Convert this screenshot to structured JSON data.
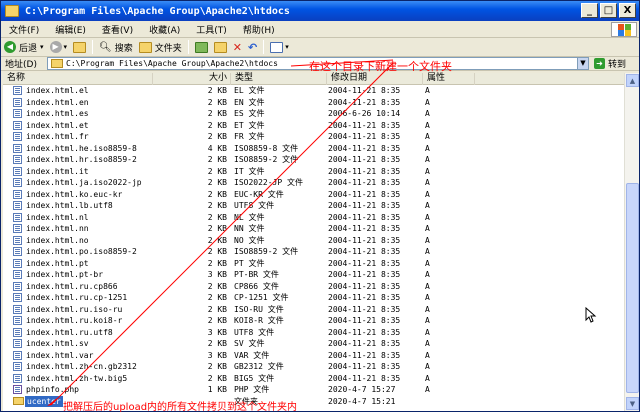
{
  "window": {
    "title": "C:\\Program Files\\Apache Group\\Apache2\\htdocs",
    "buttons": [
      "_",
      "□",
      "X"
    ]
  },
  "menu": [
    "文件(F)",
    "编辑(E)",
    "查看(V)",
    "收藏(A)",
    "工具(T)",
    "帮助(H)"
  ],
  "toolbar": {
    "back": "后退",
    "search": "搜索",
    "folders": "文件夹"
  },
  "address": {
    "label": "地址(D)",
    "path": "C:\\Program Files\\Apache Group\\Apache2\\htdocs",
    "go": "转到"
  },
  "columns": [
    "名称",
    "大小",
    "类型",
    "修改日期",
    "属性"
  ],
  "files": [
    {
      "name": "index.html.el",
      "size": "2 KB",
      "type": "EL 文件",
      "date": "2004-11-21 8:35",
      "attr": "A"
    },
    {
      "name": "index.html.en",
      "size": "2 KB",
      "type": "EN 文件",
      "date": "2004-11-21 8:35",
      "attr": "A"
    },
    {
      "name": "index.html.es",
      "size": "2 KB",
      "type": "ES 文件",
      "date": "2006-6-26 10:14",
      "attr": "A"
    },
    {
      "name": "index.html.et",
      "size": "2 KB",
      "type": "ET 文件",
      "date": "2004-11-21 8:35",
      "attr": "A"
    },
    {
      "name": "index.html.fr",
      "size": "2 KB",
      "type": "FR 文件",
      "date": "2004-11-21 8:35",
      "attr": "A"
    },
    {
      "name": "index.html.he.iso8859-8",
      "size": "4 KB",
      "type": "ISO8859-8 文件",
      "date": "2004-11-21 8:35",
      "attr": "A"
    },
    {
      "name": "index.html.hr.iso8859-2",
      "size": "2 KB",
      "type": "ISO8859-2 文件",
      "date": "2004-11-21 8:35",
      "attr": "A"
    },
    {
      "name": "index.html.it",
      "size": "2 KB",
      "type": "IT 文件",
      "date": "2004-11-21 8:35",
      "attr": "A"
    },
    {
      "name": "index.html.ja.iso2022-jp",
      "size": "2 KB",
      "type": "ISO2022-JP 文件",
      "date": "2004-11-21 8:35",
      "attr": "A"
    },
    {
      "name": "index.html.ko.euc-kr",
      "size": "2 KB",
      "type": "EUC-KR 文件",
      "date": "2004-11-21 8:35",
      "attr": "A"
    },
    {
      "name": "index.html.lb.utf8",
      "size": "2 KB",
      "type": "UTF8 文件",
      "date": "2004-11-21 8:35",
      "attr": "A"
    },
    {
      "name": "index.html.nl",
      "size": "2 KB",
      "type": "NL 文件",
      "date": "2004-11-21 8:35",
      "attr": "A"
    },
    {
      "name": "index.html.nn",
      "size": "2 KB",
      "type": "NN 文件",
      "date": "2004-11-21 8:35",
      "attr": "A"
    },
    {
      "name": "index.html.no",
      "size": "2 KB",
      "type": "NO 文件",
      "date": "2004-11-21 8:35",
      "attr": "A"
    },
    {
      "name": "index.html.po.iso8859-2",
      "size": "2 KB",
      "type": "ISO8859-2 文件",
      "date": "2004-11-21 8:35",
      "attr": "A"
    },
    {
      "name": "index.html.pt",
      "size": "2 KB",
      "type": "PT 文件",
      "date": "2004-11-21 8:35",
      "attr": "A"
    },
    {
      "name": "index.html.pt-br",
      "size": "3 KB",
      "type": "PT-BR 文件",
      "date": "2004-11-21 8:35",
      "attr": "A"
    },
    {
      "name": "index.html.ru.cp866",
      "size": "2 KB",
      "type": "CP866 文件",
      "date": "2004-11-21 8:35",
      "attr": "A"
    },
    {
      "name": "index.html.ru.cp-1251",
      "size": "2 KB",
      "type": "CP-1251 文件",
      "date": "2004-11-21 8:35",
      "attr": "A"
    },
    {
      "name": "index.html.ru.iso-ru",
      "size": "2 KB",
      "type": "ISO-RU 文件",
      "date": "2004-11-21 8:35",
      "attr": "A"
    },
    {
      "name": "index.html.ru.koi8-r",
      "size": "2 KB",
      "type": "KOI8-R 文件",
      "date": "2004-11-21 8:35",
      "attr": "A"
    },
    {
      "name": "index.html.ru.utf8",
      "size": "3 KB",
      "type": "UTF8 文件",
      "date": "2004-11-21 8:35",
      "attr": "A"
    },
    {
      "name": "index.html.sv",
      "size": "2 KB",
      "type": "SV 文件",
      "date": "2004-11-21 8:35",
      "attr": "A"
    },
    {
      "name": "index.html.var",
      "size": "3 KB",
      "type": "VAR 文件",
      "date": "2004-11-21 8:35",
      "attr": "A"
    },
    {
      "name": "index.html.zh-cn.gb2312",
      "size": "2 KB",
      "type": "GB2312 文件",
      "date": "2004-11-21 8:35",
      "attr": "A"
    },
    {
      "name": "index.html.zh-tw.big5",
      "size": "2 KB",
      "type": "BIG5 文件",
      "date": "2004-11-21 8:35",
      "attr": "A"
    },
    {
      "name": "phpinfo.php",
      "size": "1 KB",
      "type": "PHP 文件",
      "date": "2020-4-7 15:27",
      "attr": "A"
    },
    {
      "name": "ucenter",
      "size": "",
      "type": "文件夹",
      "date": "2020-4-7 15:21",
      "attr": ""
    }
  ],
  "annotations": {
    "top": "在这个目录下新建一个文件夹",
    "bottom": "把解压后的upload内的所有文件拷贝到这个文件夹内"
  },
  "colors": {
    "annotation": "#ff0000",
    "selection": "#316ac5",
    "titlebar": "#0054e3"
  }
}
